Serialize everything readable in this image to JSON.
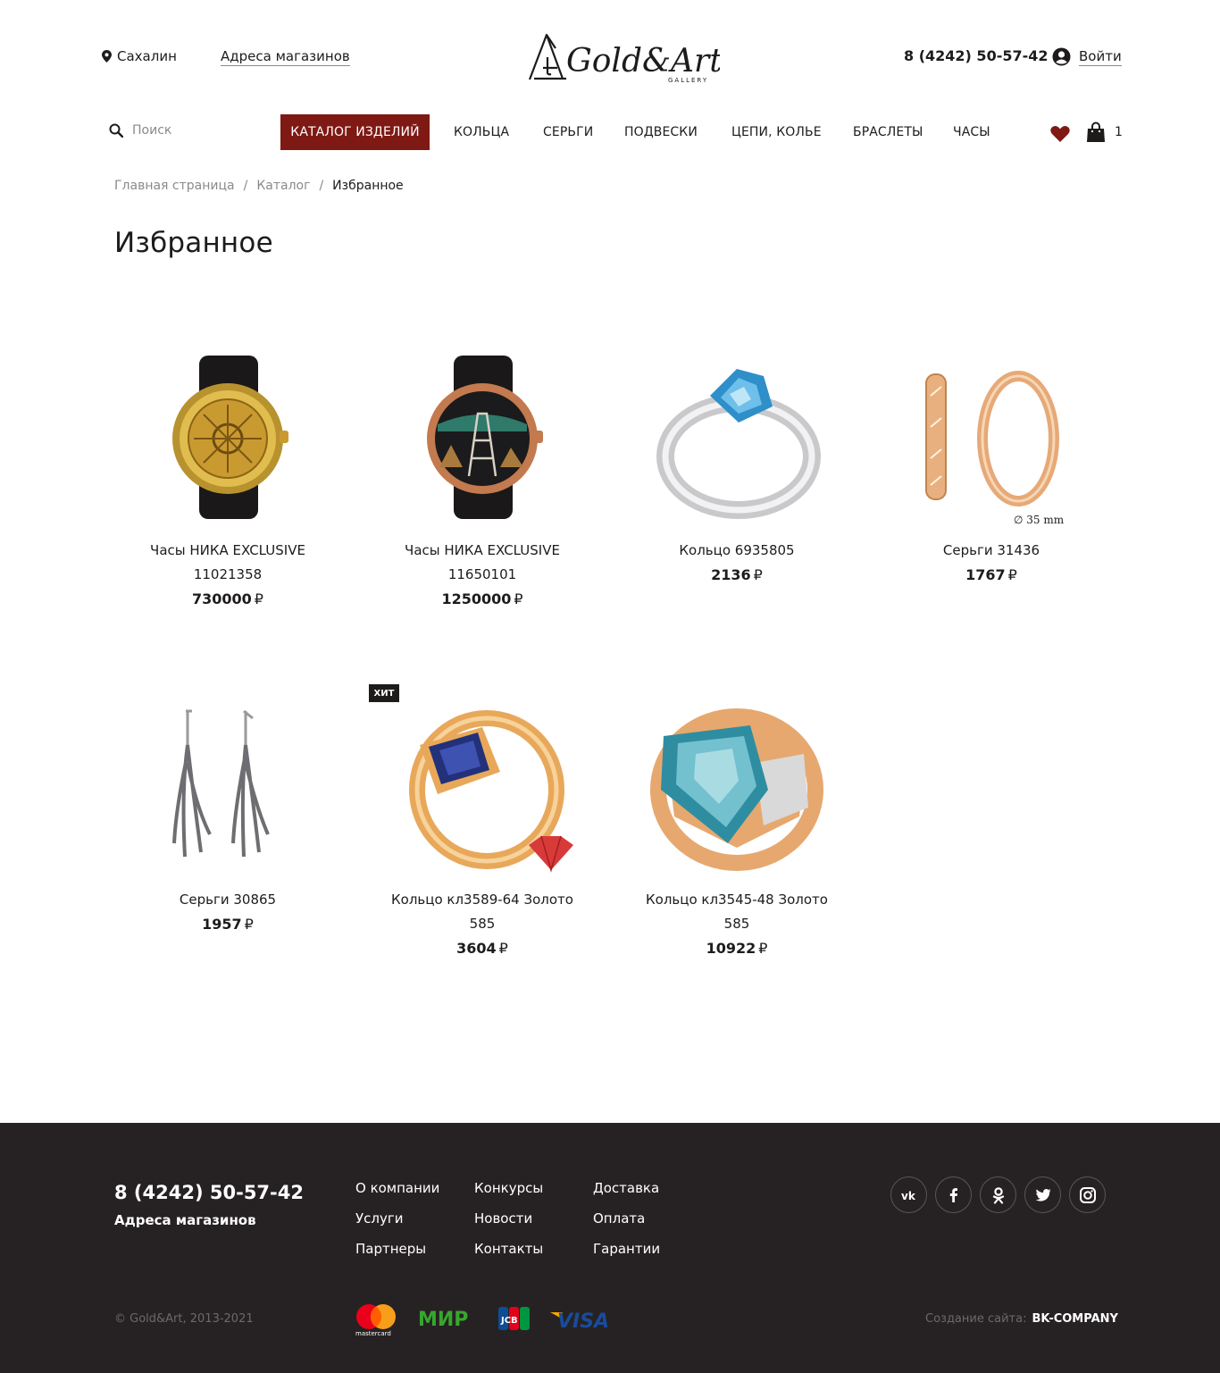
{
  "header": {
    "city": "Сахалин",
    "stores_link": "Адреса магазинов",
    "logo_text": "Gold&Art",
    "logo_sub": "GALLERY",
    "phone": "8 (4242) 50-57-42",
    "login": "Войти"
  },
  "nav": {
    "search_placeholder": "Поиск",
    "catalog": "КАТАЛОГ ИЗДЕЛИЙ",
    "items": [
      "КОЛЬЦА",
      "СЕРЬГИ",
      "ПОДВЕСКИ",
      "ЦЕПИ, КОЛЬЕ",
      "БРАСЛЕТЫ",
      "ЧАСЫ"
    ],
    "cart_count": "1",
    "accent_color": "#7f1914"
  },
  "breadcrumb": [
    "Главная страница",
    "Каталог",
    "Избранное"
  ],
  "page_title": "Избранное",
  "currency": "₽",
  "products": [
    {
      "name": "Часы НИКА EXCLUSIVE 11021358",
      "price": "730000",
      "image": "gold-watch"
    },
    {
      "name": "Часы НИКА EXCLUSIVE 11650101",
      "price": "1250000",
      "image": "rose-gold-watch"
    },
    {
      "name": "Кольцо 6935805",
      "price": "2136",
      "image": "silver-ring-blue-topaz"
    },
    {
      "name": "Серьги 31436",
      "price": "1767",
      "image": "gold-hoop-earrings",
      "size_note": "∅ 35 mm"
    },
    {
      "name": "Серьги 30865",
      "price": "1957",
      "image": "silver-drop-earrings"
    },
    {
      "name": "Кольцо кл3589-64 Золото 585",
      "price": "3604",
      "image": "gold-ring-sapphire",
      "badge": "ХИТ"
    },
    {
      "name": "Кольцо кл3545-48 Золото 585",
      "price": "10922",
      "image": "gold-ring-topaz"
    }
  ],
  "footer": {
    "phone": "8 (4242) 50-57-42",
    "stores": "Адреса магазинов",
    "links": [
      [
        "О компании",
        "Услуги",
        "Партнеры"
      ],
      [
        "Конкурсы",
        "Новости",
        "Контакты"
      ],
      [
        "Доставка",
        "Оплата",
        "Гарантии"
      ]
    ],
    "social": [
      "vk-icon",
      "facebook-icon",
      "odnoklassniki-icon",
      "twitter-icon",
      "instagram-icon"
    ],
    "copyright": "© Gold&Art, 2013-2021",
    "payments": [
      "mastercard",
      "МИР",
      "JCB",
      "VISA"
    ],
    "made_by_label": "Создание сайта:",
    "made_by": "BK-COMPANY"
  }
}
